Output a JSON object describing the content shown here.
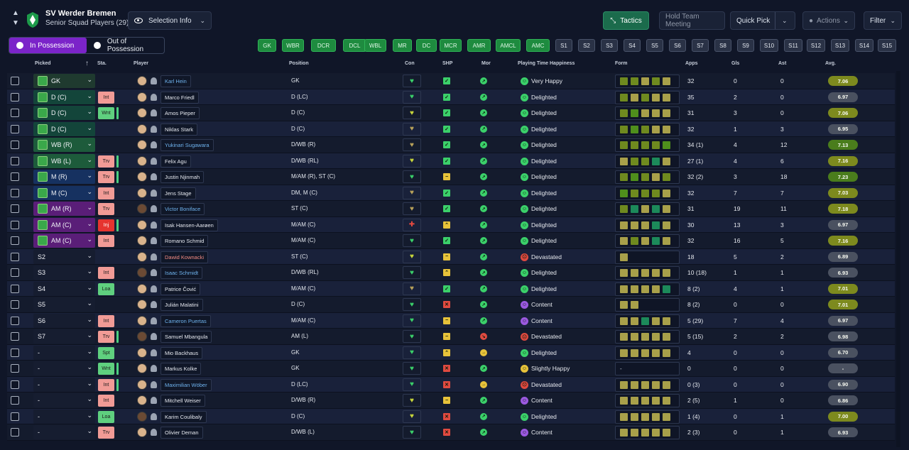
{
  "header": {
    "club_name": "SV Werder Bremen",
    "squad_sub": "Senior Squad Players (29)",
    "selection_info": "Selection Info",
    "tactics": "Tactics",
    "hold_meeting": "Hold Team Meeting",
    "quick_pick": "Quick Pick",
    "actions": "Actions",
    "filter": "Filter"
  },
  "possession": {
    "in": "In Possession",
    "out": "Out of Possession"
  },
  "position_chips": [
    {
      "label": "GK",
      "on": true
    },
    {
      "label": "WBR",
      "on": true
    },
    {
      "label": "DCR",
      "on": true
    },
    {
      "label": "DCL",
      "on": true
    },
    {
      "label": "WBL",
      "on": true
    },
    {
      "label": "MR",
      "on": true
    },
    {
      "label": "DC",
      "on": true
    },
    {
      "label": "MCR",
      "on": true
    },
    {
      "label": "AMR",
      "on": true
    },
    {
      "label": "AMCL",
      "on": true
    },
    {
      "label": "AMC",
      "on": true
    },
    {
      "label": "S1",
      "on": false
    },
    {
      "label": "S2",
      "on": false
    },
    {
      "label": "S3",
      "on": false
    },
    {
      "label": "S4",
      "on": false
    },
    {
      "label": "S5",
      "on": false
    },
    {
      "label": "S6",
      "on": false
    },
    {
      "label": "S7",
      "on": false
    },
    {
      "label": "S8",
      "on": false
    },
    {
      "label": "S9",
      "on": false
    },
    {
      "label": "S10",
      "on": false
    },
    {
      "label": "S11",
      "on": false
    },
    {
      "label": "S12",
      "on": false
    },
    {
      "label": "S13",
      "on": false
    },
    {
      "label": "S14",
      "on": false
    },
    {
      "label": "S15",
      "on": false
    }
  ],
  "columns": {
    "picked": "Picked",
    "sta": "Sta.",
    "player": "Player",
    "position": "Position",
    "con": "Con",
    "shp": "SHP",
    "mor": "Mor",
    "ptime": "Playing Time Happiness",
    "form": "Form",
    "apps": "Apps",
    "gls": "Gls",
    "ast": "Ast",
    "avg": "Avg."
  },
  "colors": {
    "form_green": "#4f8f1c",
    "form_olive": "#6f8a1f",
    "form_yellow": "#a8a04a",
    "form_teal": "#1c8a5a",
    "avg_yellow": "#7d8a1e",
    "avg_green": "#4a7d1c",
    "avg_grey": "#4a5160"
  },
  "rows": [
    {
      "picked": "GK",
      "pk": "gk",
      "marker": true,
      "sta": "",
      "name": "Karl Hein",
      "link": "link",
      "dark": false,
      "position": "GK",
      "con": "green",
      "shp": "ok",
      "mor": "g",
      "ptime": "Very Happy",
      "pt": "g",
      "form": [
        "o",
        "o",
        "y",
        "o",
        "y"
      ],
      "apps": "32",
      "gls": "0",
      "ast": "0",
      "avg": "7.06",
      "avgc": "yellow"
    },
    {
      "picked": "D (C)",
      "pk": "def",
      "marker": true,
      "sta": "Int",
      "stac": "int",
      "name": "Marco Friedl",
      "link": "",
      "dark": false,
      "position": "D (LC)",
      "con": "green",
      "shp": "ok",
      "mor": "g",
      "ptime": "Delighted",
      "pt": "g",
      "form": [
        "o",
        "y",
        "o",
        "y",
        "y"
      ],
      "apps": "35",
      "gls": "2",
      "ast": "0",
      "avg": "6.97",
      "avgc": "grey"
    },
    {
      "picked": "D (C)",
      "pk": "def",
      "marker": true,
      "sta": "Wnt",
      "stac": "wnt",
      "bar": true,
      "name": "Amos Pieper",
      "link": "",
      "dark": false,
      "position": "D (C)",
      "con": "yellow",
      "shp": "ok",
      "mor": "g",
      "ptime": "Delighted",
      "pt": "g",
      "form": [
        "o",
        "g",
        "y",
        "y",
        "y"
      ],
      "apps": "31",
      "gls": "3",
      "ast": "0",
      "avg": "7.06",
      "avgc": "yellow"
    },
    {
      "picked": "D (C)",
      "pk": "def",
      "marker": true,
      "sta": "",
      "name": "Niklas Stark",
      "link": "",
      "dark": false,
      "position": "D (C)",
      "con": "mixed",
      "shp": "ok",
      "mor": "g",
      "ptime": "Delighted",
      "pt": "g",
      "form": [
        "o",
        "g",
        "o",
        "y",
        "y"
      ],
      "apps": "32",
      "gls": "1",
      "ast": "3",
      "avg": "6.95",
      "avgc": "grey"
    },
    {
      "picked": "WB (R)",
      "pk": "wb",
      "marker": true,
      "sta": "",
      "name": "Yukinari Sugawara",
      "link": "link",
      "dark": false,
      "position": "D/WB (R)",
      "con": "mixed",
      "shp": "ok",
      "mor": "g",
      "ptime": "Delighted",
      "pt": "g",
      "form": [
        "o",
        "o",
        "o",
        "o",
        "g"
      ],
      "apps": "34 (1)",
      "gls": "4",
      "ast": "12",
      "avg": "7.13",
      "avgc": "green"
    },
    {
      "picked": "WB (L)",
      "pk": "wb",
      "marker": true,
      "sta": "Trv",
      "stac": "trv",
      "bar": true,
      "name": "Felix Agu",
      "link": "",
      "dark": false,
      "position": "D/WB (RL)",
      "con": "yellow",
      "shp": "ok",
      "mor": "g",
      "ptime": "Delighted",
      "pt": "g",
      "form": [
        "y",
        "o",
        "o",
        "t",
        "y"
      ],
      "apps": "27 (1)",
      "gls": "4",
      "ast": "6",
      "avg": "7.16",
      "avgc": "yellow"
    },
    {
      "picked": "M (R)",
      "pk": "mid",
      "marker": true,
      "sta": "Trv",
      "stac": "trv",
      "bar": true,
      "name": "Justin Njinmah",
      "link": "",
      "dark": false,
      "position": "M/AM (R), ST (C)",
      "con": "green",
      "shp": "mid",
      "mor": "g",
      "ptime": "Delighted",
      "pt": "g",
      "form": [
        "o",
        "g",
        "o",
        "y",
        "o"
      ],
      "apps": "32 (2)",
      "gls": "3",
      "ast": "18",
      "avg": "7.23",
      "avgc": "green"
    },
    {
      "picked": "M (C)",
      "pk": "mid",
      "marker": true,
      "sta": "Int",
      "stac": "int",
      "name": "Jens Stage",
      "link": "",
      "dark": false,
      "position": "DM, M (C)",
      "con": "mixed",
      "shp": "ok",
      "mor": "g",
      "ptime": "Delighted",
      "pt": "g",
      "form": [
        "g",
        "o",
        "o",
        "o",
        "y"
      ],
      "apps": "32",
      "gls": "7",
      "ast": "7",
      "avg": "7.03",
      "avgc": "yellow"
    },
    {
      "picked": "AM (R)",
      "pk": "am",
      "marker": true,
      "sta": "Trv",
      "stac": "trv",
      "name": "Victor Boniface",
      "link": "link",
      "dark": true,
      "position": "ST (C)",
      "con": "mixed",
      "shp": "ok",
      "mor": "g",
      "ptime": "Delighted",
      "pt": "g",
      "form": [
        "o",
        "t",
        "y",
        "t",
        "y"
      ],
      "apps": "31",
      "gls": "19",
      "ast": "11",
      "avg": "7.18",
      "avgc": "yellow"
    },
    {
      "picked": "AM (C)",
      "pk": "am",
      "marker": true,
      "sta": "Inj",
      "stac": "inj",
      "bar": true,
      "name": "Isak Hansen-Aarøen",
      "link": "",
      "dark": false,
      "position": "M/AM (C)",
      "con": "red",
      "shp": "up",
      "mor": "g",
      "ptime": "Delighted",
      "pt": "g",
      "form": [
        "y",
        "y",
        "y",
        "t",
        "y"
      ],
      "apps": "30",
      "gls": "13",
      "ast": "3",
      "avg": "6.97",
      "avgc": "grey"
    },
    {
      "picked": "AM (C)",
      "pk": "am",
      "marker": true,
      "sta": "Int",
      "stac": "int",
      "name": "Romano Schmid",
      "link": "",
      "dark": false,
      "position": "M/AM (C)",
      "con": "green",
      "shp": "ok",
      "mor": "g",
      "ptime": "Delighted",
      "pt": "g",
      "form": [
        "y",
        "o",
        "y",
        "t",
        "y"
      ],
      "apps": "32",
      "gls": "16",
      "ast": "5",
      "avg": "7.16",
      "avgc": "yellow"
    },
    {
      "picked": "S2",
      "pk": "plain",
      "marker": false,
      "sta": "",
      "name": "Dawid Kownacki",
      "link": "red",
      "dark": false,
      "position": "ST (C)",
      "con": "yellow",
      "shp": "mid",
      "mor": "g",
      "ptime": "Devastated",
      "pt": "r",
      "form": [
        "y"
      ],
      "apps": "18",
      "gls": "5",
      "ast": "2",
      "avg": "6.89",
      "avgc": "grey"
    },
    {
      "picked": "S3",
      "pk": "plain",
      "marker": false,
      "sta": "Int",
      "stac": "int",
      "name": "Isaac Schmidt",
      "link": "link",
      "dark": true,
      "position": "D/WB (RL)",
      "con": "green",
      "shp": "up",
      "mor": "g",
      "ptime": "Delighted",
      "pt": "g",
      "form": [
        "y",
        "y",
        "y",
        "y",
        "y"
      ],
      "apps": "10 (18)",
      "gls": "1",
      "ast": "1",
      "avg": "6.93",
      "avgc": "grey"
    },
    {
      "picked": "S4",
      "pk": "plain",
      "marker": false,
      "sta": "Loa",
      "stac": "loa",
      "name": "Patrice Čović",
      "link": "",
      "dark": false,
      "position": "M/AM (C)",
      "con": "mixed",
      "shp": "ok",
      "mor": "g",
      "ptime": "Delighted",
      "pt": "g",
      "form": [
        "y",
        "y",
        "y",
        "y",
        "t"
      ],
      "apps": "8 (2)",
      "gls": "4",
      "ast": "1",
      "avg": "7.01",
      "avgc": "yellow"
    },
    {
      "picked": "S5",
      "pk": "plain",
      "marker": false,
      "sta": "",
      "name": "Julián Malatini",
      "link": "",
      "dark": false,
      "position": "D (C)",
      "con": "green",
      "shp": "x",
      "mor": "g",
      "ptime": "Content",
      "pt": "p",
      "form": [
        "y",
        "y"
      ],
      "apps": "8 (2)",
      "gls": "0",
      "ast": "0",
      "avg": "7.01",
      "avgc": "yellow"
    },
    {
      "picked": "S6",
      "pk": "plain",
      "marker": false,
      "sta": "Int",
      "stac": "int",
      "name": "Cameron Puertas",
      "link": "link",
      "dark": false,
      "position": "M/AM (C)",
      "con": "green",
      "shp": "mid",
      "mor": "g",
      "ptime": "Content",
      "pt": "p",
      "form": [
        "y",
        "y",
        "t",
        "y",
        "y"
      ],
      "apps": "5 (29)",
      "gls": "7",
      "ast": "4",
      "avg": "6.97",
      "avgc": "grey"
    },
    {
      "picked": "S7",
      "pk": "plain",
      "marker": false,
      "sta": "Trv",
      "stac": "trv",
      "bar": true,
      "name": "Samuel Mbangula",
      "link": "",
      "dark": true,
      "position": "AM (L)",
      "con": "green",
      "shp": "mid",
      "mor": "r",
      "ptime": "Devastated",
      "pt": "r",
      "form": [
        "y",
        "y",
        "y",
        "y",
        "y"
      ],
      "apps": "5 (15)",
      "gls": "2",
      "ast": "2",
      "avg": "6.98",
      "avgc": "grey"
    },
    {
      "picked": "-",
      "pk": "plain",
      "marker": false,
      "sta": "Spt",
      "stac": "spt",
      "name": "Mio Backhaus",
      "link": "",
      "dark": false,
      "position": "GK",
      "con": "green",
      "shp": "up",
      "mor": "y",
      "ptime": "Delighted",
      "pt": "g",
      "form": [
        "y",
        "y",
        "y",
        "y",
        "y"
      ],
      "apps": "4",
      "gls": "0",
      "ast": "0",
      "avg": "6.70",
      "avgc": "grey"
    },
    {
      "picked": "-",
      "pk": "plain",
      "marker": false,
      "sta": "Wnt",
      "stac": "wnt",
      "bar": true,
      "name": "Markus Kolke",
      "link": "",
      "dark": false,
      "position": "GK",
      "con": "green",
      "shp": "x",
      "mor": "g",
      "ptime": "Slightly Happy",
      "pt": "y",
      "form": [],
      "apps": "0",
      "gls": "0",
      "ast": "0",
      "avg": "-",
      "avgc": "grey"
    },
    {
      "picked": "-",
      "pk": "plain",
      "marker": false,
      "sta": "Int",
      "stac": "int",
      "bar": true,
      "name": "Maximilian Wöber",
      "link": "link",
      "dark": false,
      "position": "D (LC)",
      "con": "green",
      "shp": "x",
      "mor": "y",
      "ptime": "Devastated",
      "pt": "r",
      "form": [
        "y",
        "y",
        "y",
        "y",
        "y"
      ],
      "apps": "0 (3)",
      "gls": "0",
      "ast": "0",
      "avg": "6.90",
      "avgc": "grey"
    },
    {
      "picked": "-",
      "pk": "plain",
      "marker": false,
      "sta": "Int",
      "stac": "int",
      "name": "Mitchell Weiser",
      "link": "",
      "dark": false,
      "position": "D/WB (R)",
      "con": "yellow",
      "shp": "mid",
      "mor": "g",
      "ptime": "Content",
      "pt": "p",
      "form": [
        "y",
        "y",
        "y",
        "y",
        "y"
      ],
      "apps": "2 (5)",
      "gls": "1",
      "ast": "0",
      "avg": "6.86",
      "avgc": "grey"
    },
    {
      "picked": "-",
      "pk": "plain",
      "marker": false,
      "sta": "Loa",
      "stac": "loa",
      "name": "Karim Coulibaly",
      "link": "",
      "dark": true,
      "position": "D (C)",
      "con": "yellow",
      "shp": "x",
      "mor": "g",
      "ptime": "Delighted",
      "pt": "g",
      "form": [
        "y",
        "y",
        "y",
        "y",
        "y"
      ],
      "apps": "1 (4)",
      "gls": "0",
      "ast": "1",
      "avg": "7.00",
      "avgc": "yellow"
    },
    {
      "picked": "-",
      "pk": "plain",
      "marker": false,
      "sta": "Trv",
      "stac": "trv",
      "name": "Olivier Deman",
      "link": "",
      "dark": false,
      "position": "D/WB (L)",
      "con": "green",
      "shp": "x",
      "mor": "g",
      "ptime": "Content",
      "pt": "p",
      "form": [
        "y",
        "y",
        "y",
        "y",
        "y"
      ],
      "apps": "2 (3)",
      "gls": "0",
      "ast": "1",
      "avg": "6.93",
      "avgc": "grey"
    }
  ]
}
